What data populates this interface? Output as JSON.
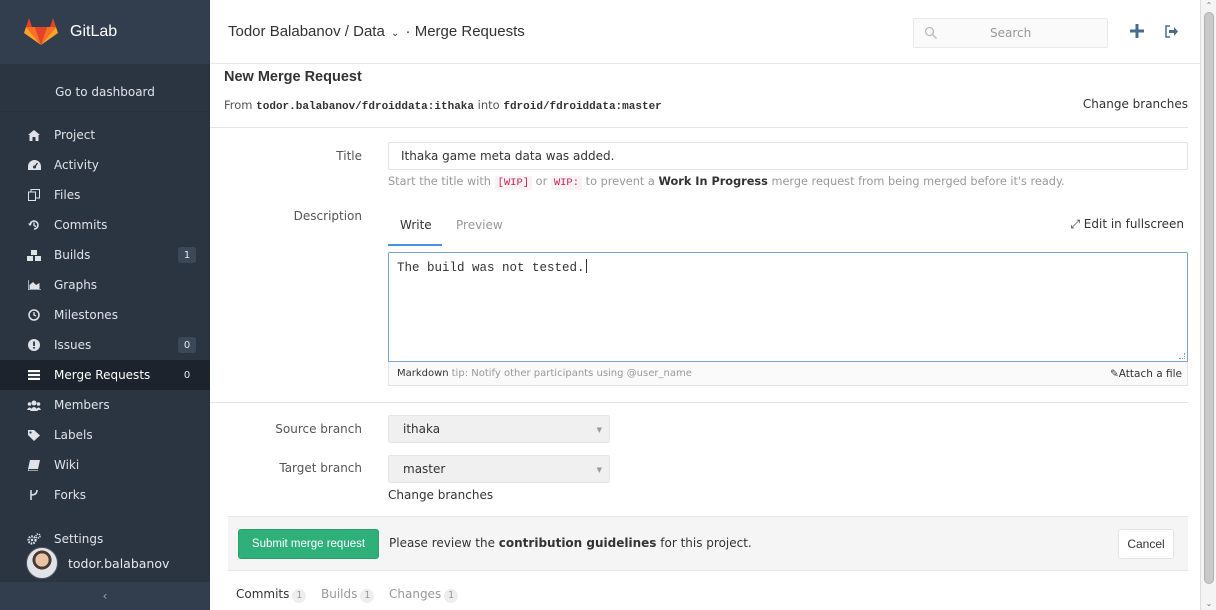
{
  "sidebar": {
    "app_name": "GitLab",
    "dashboard_link": "Go to dashboard",
    "items": [
      {
        "label": "Project",
        "icon": "home-icon",
        "count": null
      },
      {
        "label": "Activity",
        "icon": "dashboard-icon",
        "count": null
      },
      {
        "label": "Files",
        "icon": "files-icon",
        "count": null
      },
      {
        "label": "Commits",
        "icon": "history-icon",
        "count": null
      },
      {
        "label": "Builds",
        "icon": "cubes-icon",
        "count": "1"
      },
      {
        "label": "Graphs",
        "icon": "area-chart-icon",
        "count": null
      },
      {
        "label": "Milestones",
        "icon": "clock-icon",
        "count": null
      },
      {
        "label": "Issues",
        "icon": "exclamation-circle-icon",
        "count": "0"
      },
      {
        "label": "Merge Requests",
        "icon": "tasks-icon",
        "count": "0",
        "active": true
      },
      {
        "label": "Members",
        "icon": "users-icon",
        "count": null
      },
      {
        "label": "Labels",
        "icon": "tags-icon",
        "count": null
      },
      {
        "label": "Wiki",
        "icon": "book-icon",
        "count": null
      },
      {
        "label": "Forks",
        "icon": "code-fork-icon",
        "count": null
      }
    ],
    "settings_label": "Settings",
    "username": "todor.balabanov",
    "collapse_glyph": "‹"
  },
  "header": {
    "breadcrumb_user": "Todor Balabanov",
    "breadcrumb_sep": "/",
    "breadcrumb_project": "Data",
    "breadcrumb_page": "· Merge Requests",
    "search_placeholder": "Search"
  },
  "form": {
    "page_title": "New Merge Request",
    "from_prefix": "From",
    "source_ref": "todor.balabanov/fdroiddata:ithaka",
    "into_word": "into",
    "target_ref": "fdroid/fdroiddata:master",
    "change_branches_label": "Change branches",
    "title_label": "Title",
    "title_value": "Ithaka game meta data was added.",
    "hint_prefix": "Start the title with",
    "hint_wip1": "[WIP]",
    "hint_or": "or",
    "hint_wip2": "WIP:",
    "hint_mid": "to prevent a",
    "hint_bold": "Work In Progress",
    "hint_suffix": "merge request from being merged before it's ready.",
    "description_label": "Description",
    "tab_write": "Write",
    "tab_preview": "Preview",
    "fullscreen_label": "Edit in fullscreen",
    "description_value": "The build was not tested.",
    "markdown_label": "Markdown",
    "markdown_tip": "tip: Notify other participants using @user_name",
    "attach_label": "Attach a file",
    "source_branch_label": "Source branch",
    "source_branch_value": "ithaka",
    "target_branch_label": "Target branch",
    "target_branch_value": "master",
    "change_branches_link": "Change branches"
  },
  "actions": {
    "submit_label": "Submit merge request",
    "review_prefix": "Please review the",
    "review_link": "contribution guidelines",
    "review_suffix": "for this project.",
    "cancel_label": "Cancel"
  },
  "bottom_tabs": [
    {
      "label": "Commits",
      "count": "1"
    },
    {
      "label": "Builds",
      "count": "1"
    },
    {
      "label": "Changes",
      "count": "1"
    }
  ],
  "colors": {
    "sidebar_bg": "#2b3542",
    "submit_green": "#2fb07a",
    "active_tab_blue": "#4a90e2"
  }
}
